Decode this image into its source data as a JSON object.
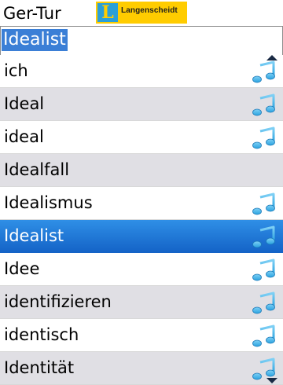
{
  "header": {
    "dictionary_direction": "Ger-Tur",
    "brand_mark": "L",
    "brand_name": "Langenscheidt"
  },
  "search": {
    "value": "Idealist"
  },
  "entries": [
    {
      "label": "ich",
      "audio": true
    },
    {
      "label": "Ideal",
      "audio": true
    },
    {
      "label": "ideal",
      "audio": true
    },
    {
      "label": "Idealfall",
      "audio": false
    },
    {
      "label": "Idealismus",
      "audio": true
    },
    {
      "label": "Idealist",
      "audio": true,
      "selected": true
    },
    {
      "label": "Idee",
      "audio": true
    },
    {
      "label": "identifizieren",
      "audio": true
    },
    {
      "label": "identisch",
      "audio": true
    },
    {
      "label": "Identität",
      "audio": true
    }
  ],
  "colors": {
    "selection": "#1463c7",
    "alt_row": "#e0dfe4",
    "brand_yellow": "#ffcc00",
    "brand_blue": "#2a9fd8",
    "note_icon": "#2aa3e0"
  },
  "icons": {
    "audio": "music-note-icon",
    "scroll_up": "scroll-up-arrow-icon",
    "scroll_down": "scroll-down-arrow-icon"
  }
}
